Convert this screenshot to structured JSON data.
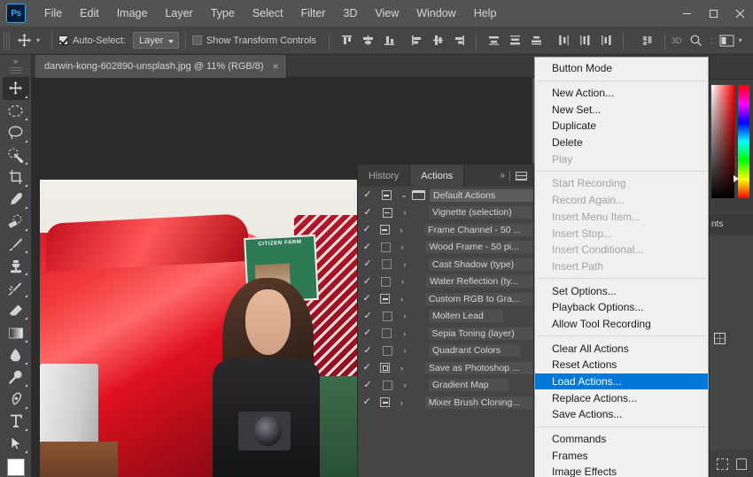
{
  "app": {
    "logo": "Ps"
  },
  "menubar": {
    "items": [
      "File",
      "Edit",
      "Image",
      "Layer",
      "Type",
      "Select",
      "Filter",
      "3D",
      "View",
      "Window",
      "Help"
    ],
    "window_controls": [
      "minimize",
      "maximize",
      "close"
    ]
  },
  "options_bar": {
    "tool_icon": "move-tool-icon",
    "auto_select": {
      "label": "Auto-Select:",
      "checked": true
    },
    "layer_select": {
      "value": "Layer"
    },
    "show_transform": {
      "label": "Show Transform Controls",
      "checked": false
    },
    "align_icons": [
      "align-top-edges-icon",
      "align-vertical-centers-icon",
      "align-bottom-edges-icon",
      "align-left-edges-icon",
      "align-horizontal-centers-icon",
      "align-right-edges-icon"
    ],
    "distribute_icons": [
      "distribute-top-edges-icon",
      "distribute-vertical-centers-icon",
      "distribute-bottom-edges-icon",
      "distribute-left-edges-icon",
      "distribute-horizontal-centers-icon",
      "distribute-right-edges-icon"
    ],
    "three_d_label": "3D",
    "right_icons": [
      "grid-arrange-icon",
      "search-icon",
      "workspace-switcher-icon"
    ]
  },
  "toolbar": {
    "collapse": "»",
    "tools": [
      {
        "name": "move-tool",
        "active": true
      },
      {
        "name": "elliptical-marquee-tool",
        "active": false
      },
      {
        "name": "lasso-tool",
        "active": false
      },
      {
        "name": "quick-selection-tool",
        "active": false
      },
      {
        "name": "crop-tool",
        "active": false
      },
      {
        "name": "eyedropper-tool",
        "active": false
      },
      {
        "name": "spot-healing-brush-tool",
        "active": false
      },
      {
        "name": "brush-tool",
        "active": false
      },
      {
        "name": "clone-stamp-tool",
        "active": false
      },
      {
        "name": "history-brush-tool",
        "active": false
      },
      {
        "name": "eraser-tool",
        "active": false
      },
      {
        "name": "gradient-tool",
        "active": false
      },
      {
        "name": "blur-tool",
        "active": false
      },
      {
        "name": "dodge-tool",
        "active": false
      },
      {
        "name": "pen-tool",
        "active": false
      },
      {
        "name": "type-tool",
        "active": false
      },
      {
        "name": "path-selection-tool",
        "active": false
      },
      {
        "name": "rectangle-tool",
        "active": false
      }
    ]
  },
  "document": {
    "tab_title": "darwin-kong-602890-unsplash.jpg @ 11% (RGB/8)",
    "close": "×",
    "photo": {
      "sign_text": "CITIZEN FARM"
    }
  },
  "actions_panel": {
    "tabs": [
      {
        "label": "History",
        "active": false
      },
      {
        "label": "Actions",
        "active": true
      }
    ],
    "header_icons": [
      "collapse-chevrons-icon",
      "panel-menu-icon"
    ],
    "rows": [
      {
        "checked": true,
        "modal": "filled",
        "type": "set",
        "twirl": "⌄",
        "label": "Default Actions"
      },
      {
        "checked": true,
        "modal": "filled",
        "type": "item",
        "twirl": "›",
        "label": "Vignette (selection)"
      },
      {
        "checked": true,
        "modal": "filled",
        "type": "item",
        "twirl": "›",
        "label": "Frame Channel - 50 ..."
      },
      {
        "checked": true,
        "modal": "empty",
        "type": "item",
        "twirl": "›",
        "label": "Wood Frame - 50 pi..."
      },
      {
        "checked": true,
        "modal": "empty",
        "type": "item",
        "twirl": "›",
        "label": "Cast Shadow (type)"
      },
      {
        "checked": true,
        "modal": "empty",
        "type": "item",
        "twirl": "›",
        "label": "Water Reflection (ty..."
      },
      {
        "checked": true,
        "modal": "filled",
        "type": "item",
        "twirl": "›",
        "label": "Custom RGB to Gra..."
      },
      {
        "checked": true,
        "modal": "empty",
        "type": "item",
        "twirl": "›",
        "label": "Molten Lead"
      },
      {
        "checked": true,
        "modal": "empty",
        "type": "item",
        "twirl": "›",
        "label": "Sepia Toning (layer)"
      },
      {
        "checked": true,
        "modal": "empty",
        "type": "item",
        "twirl": "›",
        "label": "Quadrant Colors"
      },
      {
        "checked": true,
        "modal": "hollow2",
        "type": "item",
        "twirl": "›",
        "label": "Save as Photoshop ..."
      },
      {
        "checked": true,
        "modal": "empty",
        "type": "item",
        "twirl": "›",
        "label": "Gradient Map"
      },
      {
        "checked": true,
        "modal": "filled",
        "type": "item",
        "twirl": "›",
        "label": "Mixer Brush Cloning..."
      }
    ],
    "check_glyph": "✓"
  },
  "actions_menu": {
    "groups": [
      {
        "items": [
          {
            "label": "Button Mode",
            "state": "normal"
          }
        ]
      },
      {
        "items": [
          {
            "label": "New Action...",
            "state": "normal"
          },
          {
            "label": "New Set...",
            "state": "normal"
          },
          {
            "label": "Duplicate",
            "state": "normal"
          },
          {
            "label": "Delete",
            "state": "normal"
          },
          {
            "label": "Play",
            "state": "disabled"
          }
        ]
      },
      {
        "items": [
          {
            "label": "Start Recording",
            "state": "disabled"
          },
          {
            "label": "Record Again...",
            "state": "disabled"
          },
          {
            "label": "Insert Menu Item...",
            "state": "disabled"
          },
          {
            "label": "Insert Stop...",
            "state": "disabled"
          },
          {
            "label": "Insert Conditional...",
            "state": "disabled"
          },
          {
            "label": "Insert Path",
            "state": "disabled"
          }
        ]
      },
      {
        "items": [
          {
            "label": "Set Options...",
            "state": "normal"
          },
          {
            "label": "Playback Options...",
            "state": "normal"
          },
          {
            "label": "Allow Tool Recording",
            "state": "normal"
          }
        ]
      },
      {
        "items": [
          {
            "label": "Clear All Actions",
            "state": "normal"
          },
          {
            "label": "Reset Actions",
            "state": "normal"
          },
          {
            "label": "Load Actions...",
            "state": "selected"
          },
          {
            "label": "Replace Actions...",
            "state": "normal"
          },
          {
            "label": "Save Actions...",
            "state": "normal"
          }
        ]
      },
      {
        "items": [
          {
            "label": "Commands",
            "state": "normal"
          },
          {
            "label": "Frames",
            "state": "normal"
          },
          {
            "label": "Image Effects",
            "state": "normal"
          }
        ]
      }
    ],
    "highlight_color": "#0078d7"
  },
  "right_dock": {
    "color_panel": {
      "name": "color-picker",
      "primary": "#ff0000"
    },
    "adjustments_tab": "nts",
    "footer_icons": [
      "new-artboard-icon",
      "new-layer-icon"
    ]
  }
}
